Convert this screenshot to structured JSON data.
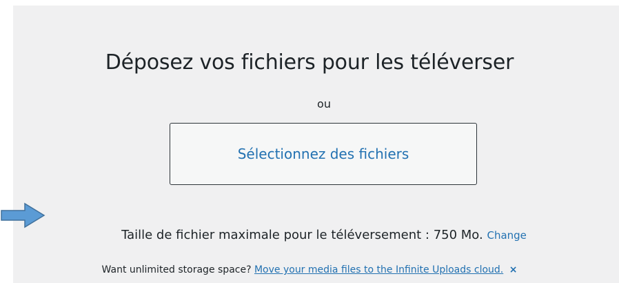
{
  "uploader": {
    "drop_title": "Déposez vos fichiers pour les téléverser",
    "or_text": "ou",
    "select_button_label": "Sélectionnez des fichiers",
    "max_size_text": "Taille de fichier maximale pour le téléversement : 750 Mo.",
    "change_link": "Change"
  },
  "promo": {
    "text": "Want unlimited storage space?",
    "link_text": "Move your media files to the Infinite Uploads cloud.",
    "dismiss_glyph": "×"
  },
  "colors": {
    "panel_background": "#f0f0f1",
    "link_blue": "#2271b1",
    "arrow_blue": "#5b9bd5"
  },
  "icons": {
    "arrow": "right-arrow-icon",
    "dismiss": "close-icon"
  }
}
